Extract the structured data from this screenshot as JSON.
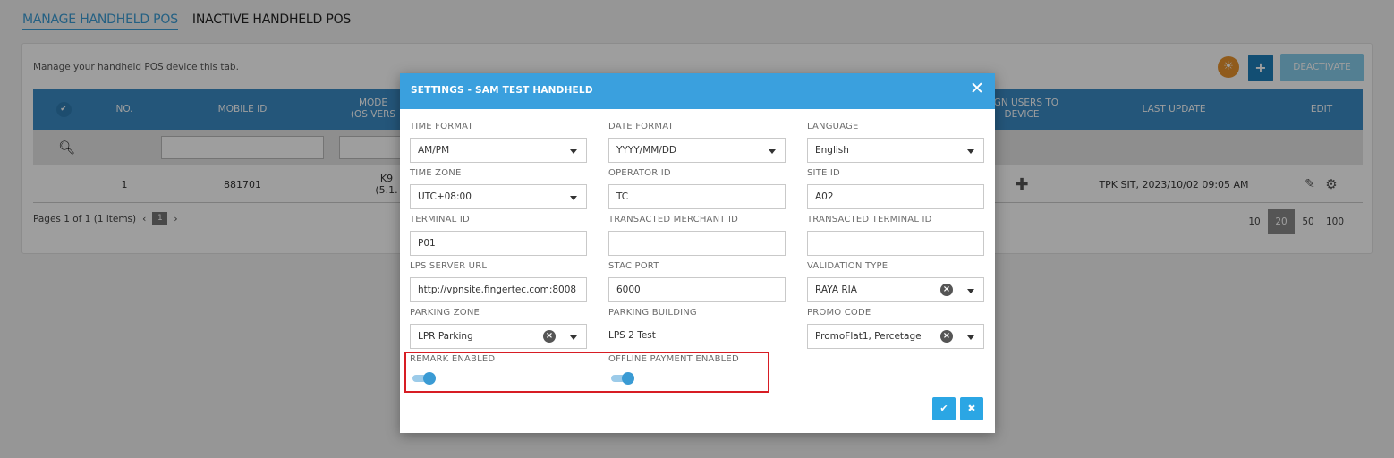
{
  "tabs": {
    "manage": "MANAGE HANDHELD POS",
    "inactive": "INACTIVE HANDHELD POS"
  },
  "panel": {
    "hint": "Manage your handheld POS device this tab.",
    "deactivate_label": "DEACTIVATE",
    "add_label": "+"
  },
  "table": {
    "headers": {
      "no": "NO.",
      "mobile_id": "MOBILE ID",
      "model_1": "MODE",
      "model_2": "(OS VERS",
      "assign_1": "SIGN USERS TO",
      "assign_2": "DEVICE",
      "last_update": "LAST UPDATE",
      "edit": "EDIT"
    },
    "row": {
      "no": "1",
      "mobile_id": "881701",
      "model_1": "K9",
      "model_2": "(5.1.",
      "last_update": "TPK SIT, 2023/10/02 09:05 AM"
    },
    "pager_text": "Pages 1 of 1 (1 items)",
    "current_page": "1",
    "page_sizes": [
      "10",
      "20",
      "50",
      "100"
    ],
    "selected_page_size": "20"
  },
  "modal": {
    "title": "SETTINGS - SAM TEST HANDHELD",
    "fields": {
      "time_format": {
        "label": "TIME FORMAT",
        "value": "AM/PM"
      },
      "date_format": {
        "label": "DATE FORMAT",
        "value": "YYYY/MM/DD"
      },
      "language": {
        "label": "LANGUAGE",
        "value": "English"
      },
      "time_zone": {
        "label": "TIME ZONE",
        "value": "UTC+08:00"
      },
      "operator_id": {
        "label": "OPERATOR ID",
        "value": "TC"
      },
      "site_id": {
        "label": "SITE ID",
        "value": "A02"
      },
      "terminal_id": {
        "label": "TERMINAL ID",
        "value": "P01"
      },
      "transacted_merchant_id": {
        "label": "TRANSACTED MERCHANT ID",
        "value": ""
      },
      "transacted_terminal_id": {
        "label": "TRANSACTED TERMINAL ID",
        "value": ""
      },
      "lps_server_url": {
        "label": "LPS SERVER URL",
        "value": "http://vpnsite.fingertec.com:8008"
      },
      "stac_port": {
        "label": "STAC PORT",
        "value": "6000"
      },
      "validation_type": {
        "label": "VALIDATION TYPE",
        "value": "RAYA RIA"
      },
      "parking_zone": {
        "label": "PARKING ZONE",
        "value": "LPR Parking"
      },
      "parking_building": {
        "label": "PARKING BUILDING",
        "value": "LPS 2 Test"
      },
      "promo_code": {
        "label": "PROMO CODE",
        "value": "PromoFlat1, Percetage"
      }
    },
    "toggles": {
      "remark_enabled": {
        "label": "REMARK ENABLED",
        "on": true
      },
      "offline_payment_enabled": {
        "label": "OFFLINE PAYMENT ENABLED",
        "on": true
      }
    }
  },
  "colors": {
    "accent": "#3aa0de",
    "header_bar": "#3a8cc6",
    "highlight_box": "#d71d24",
    "toggle_on": "#3a9bd4"
  }
}
